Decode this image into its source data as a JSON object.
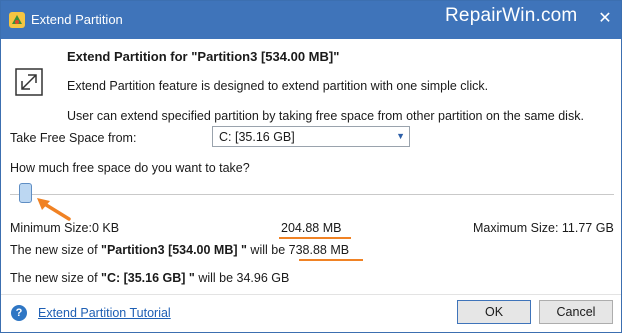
{
  "window": {
    "title": "Extend Partition",
    "watermark": "RepairWin.com",
    "close_symbol": "✕"
  },
  "header": {
    "heading": "Extend Partition for \"Partition3 [534.00 MB]\"",
    "description_1": "Extend Partition feature is designed to extend partition with one simple click.",
    "description_2": "User can extend specified partition by taking free space from other partition on the same disk."
  },
  "source": {
    "label": "Take Free Space from:",
    "selected": "C:  [35.16 GB]"
  },
  "slider": {
    "question": "How much free space do you want to take?",
    "level_fraction": 0.017
  },
  "sizes": {
    "minimum": "Minimum Size:0 KB",
    "selected": "204.88 MB",
    "maximum": "Maximum Size: 11.77 GB"
  },
  "result_1": {
    "prefix": "The new size of ",
    "name": "\"Partition3 [534.00 MB] \"",
    "middle": " will be ",
    "value": "738.88 MB"
  },
  "result_2": {
    "prefix": "The new size of ",
    "name": "\"C: [35.16 GB] \"",
    "middle": " will be 34.96 GB"
  },
  "footer": {
    "help_symbol": "?",
    "tutorial_link": "Extend Partition Tutorial",
    "ok_label": "OK",
    "cancel_label": "Cancel"
  },
  "colors": {
    "titlebar": "#3f74ba",
    "annotation": "#f08224",
    "link": "#1e5fb4"
  }
}
